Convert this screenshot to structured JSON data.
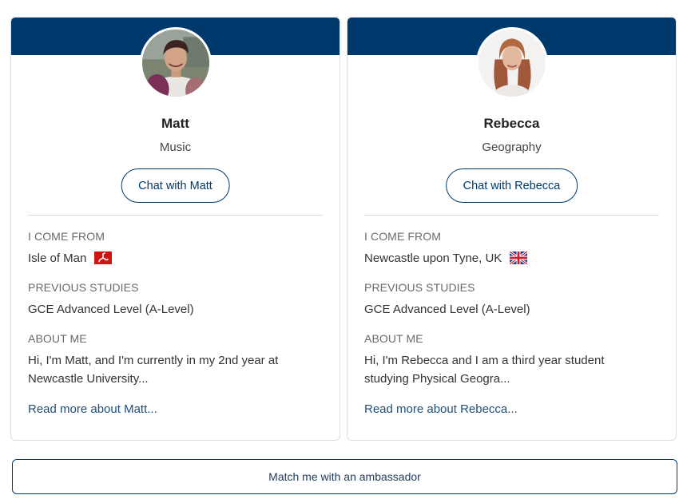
{
  "ambassadors": [
    {
      "name": "Matt",
      "subject": "Music",
      "chat_label": "Chat with Matt",
      "come_from_label": "I COME FROM",
      "come_from": "Isle of Man",
      "flag_icon": "isle-of-man-flag-icon",
      "previous_studies_label": "PREVIOUS STUDIES",
      "previous_studies": "GCE Advanced Level (A-Level)",
      "about_label": "ABOUT ME",
      "about": "Hi, I'm Matt, and I'm currently in my 2nd year at Newcastle University...",
      "read_more": "Read more about Matt..."
    },
    {
      "name": "Rebecca",
      "subject": "Geography",
      "chat_label": "Chat with Rebecca",
      "come_from_label": "I COME FROM",
      "come_from": "Newcastle upon Tyne, UK",
      "flag_icon": "uk-flag-icon",
      "previous_studies_label": "PREVIOUS STUDIES",
      "previous_studies": "GCE Advanced Level (A-Level)",
      "about_label": "ABOUT ME",
      "about": "Hi, I'm Rebecca and I am a third year student studying Physical Geogra...",
      "read_more": "Read more about Rebecca..."
    }
  ],
  "match_button_label": "Match me with an ambassador",
  "colors": {
    "banner": "#003a6c",
    "link": "#1f4e79",
    "border": "#dcdfe3"
  }
}
